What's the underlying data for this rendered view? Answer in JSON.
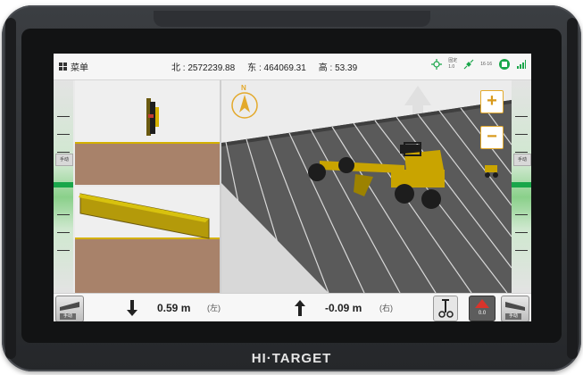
{
  "status_bar": {
    "menu_label": "菜单",
    "north": "北 : 2572239.88",
    "east": "东 : 464069.31",
    "height": "高 : 53.39",
    "fix_status": "固定",
    "fix_value": "1.0",
    "satellites": "16·16"
  },
  "side_buttons": {
    "left_manual": "手动",
    "right_manual": "手动"
  },
  "bottom_bar": {
    "left_value": "0.59 m",
    "left_side": "(左)",
    "right_value": "-0.09 m",
    "right_side": "(右)",
    "alarm_value": "0.0",
    "left_corner_label": "手动",
    "right_corner_label": "手动"
  },
  "main_view": {
    "compass_label": "N",
    "zoom_in": "+",
    "zoom_out": "−"
  },
  "device": {
    "brand": "HI·TARGET"
  },
  "colors": {
    "accent": "#e3a92b",
    "fix_green": "#19a64a",
    "alarm_red": "#d9342b",
    "grade_blade": "#c9a400"
  }
}
